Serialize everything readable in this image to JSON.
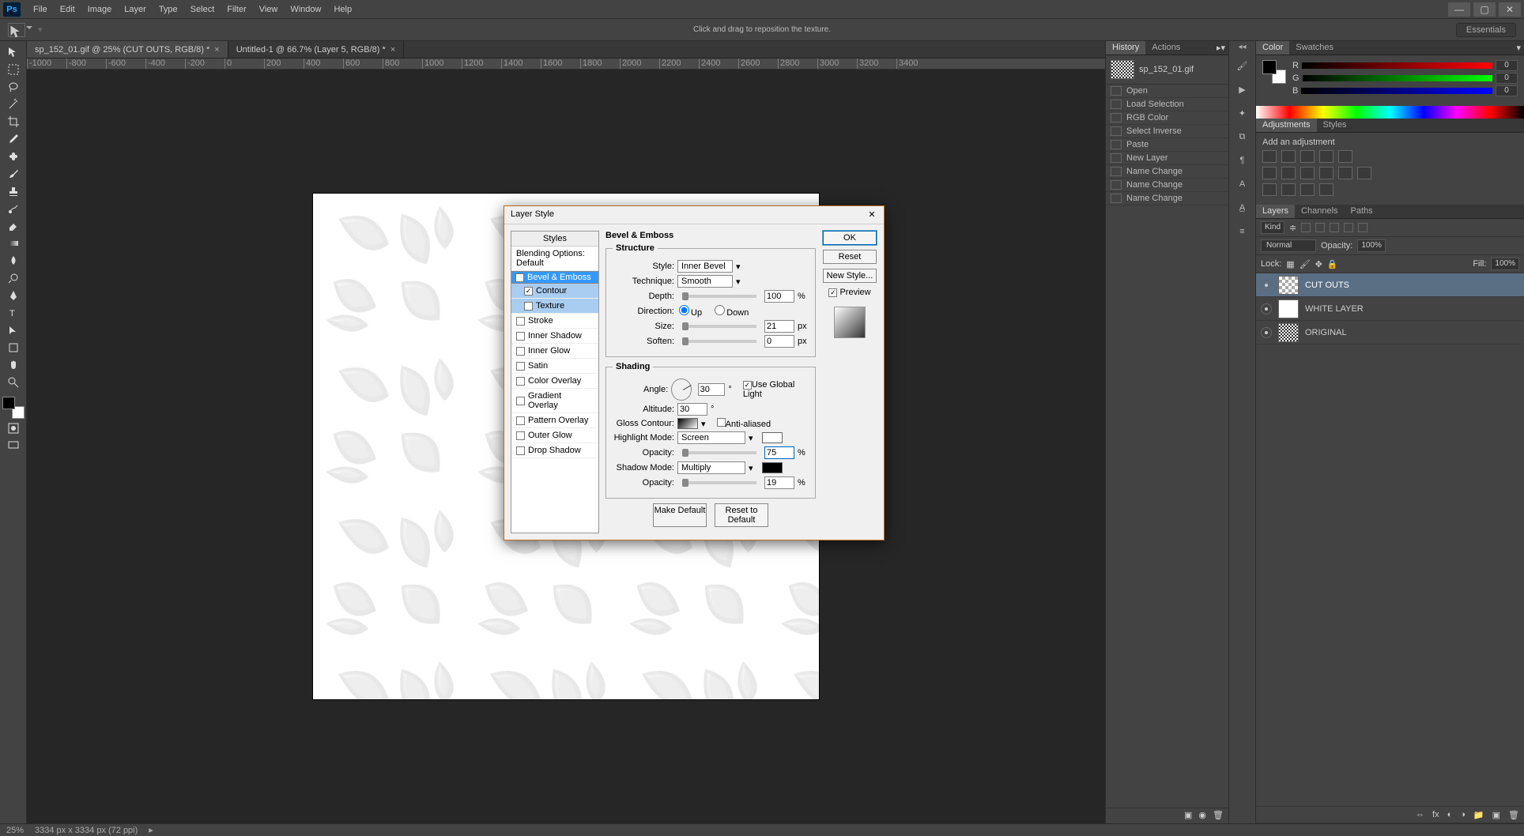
{
  "menu": {
    "items": [
      "File",
      "Edit",
      "Image",
      "Layer",
      "Type",
      "Select",
      "Filter",
      "View",
      "Window",
      "Help"
    ]
  },
  "optionsbar": {
    "hint": "Click and drag to reposition the texture.",
    "workspace": "Essentials"
  },
  "doctabs": [
    {
      "label": "sp_152_01.gif @ 25% (CUT OUTS, RGB/8) *",
      "active": true
    },
    {
      "label": "Untitled-1 @ 66.7% (Layer 5, RGB/8) *",
      "active": false
    }
  ],
  "ruler": [
    "-1000",
    "-800",
    "-600",
    "-400",
    "-200",
    "0",
    "200",
    "400",
    "600",
    "800",
    "1000",
    "1200",
    "1400",
    "1600",
    "1800",
    "2000",
    "2200",
    "2400",
    "2600",
    "2800",
    "3000",
    "3200",
    "3400"
  ],
  "status": {
    "zoom": "25%",
    "docinfo": "3334 px x 3334 px (72 ppi)"
  },
  "history": {
    "tabs": [
      "History",
      "Actions"
    ],
    "snapshot": "sp_152_01.gif",
    "items": [
      "Open",
      "Load Selection",
      "RGB Color",
      "Select Inverse",
      "Paste",
      "New Layer",
      "Name Change",
      "Name Change",
      "Name Change"
    ]
  },
  "color": {
    "tabs": [
      "Color",
      "Swatches"
    ],
    "r": "0",
    "g": "0",
    "b": "0"
  },
  "adjustments": {
    "tabs": [
      "Adjustments",
      "Styles"
    ],
    "hint": "Add an adjustment"
  },
  "layers": {
    "tabs": [
      "Layers",
      "Channels",
      "Paths"
    ],
    "kind": "Kind",
    "blend": "Normal",
    "opacity_label": "Opacity:",
    "opacity": "100%",
    "lock_label": "Lock:",
    "fill_label": "Fill:",
    "fill": "100%",
    "items": [
      {
        "name": "CUT OUTS",
        "selected": true,
        "thumb": "checker"
      },
      {
        "name": "WHITE LAYER",
        "selected": false,
        "thumb": "white"
      },
      {
        "name": "ORIGINAL",
        "selected": false,
        "thumb": "pattern"
      }
    ]
  },
  "dialog": {
    "title": "Layer Style",
    "styles_header": "Styles",
    "style_items": [
      {
        "label": "Blending Options: Default",
        "checked": false,
        "sel": false
      },
      {
        "label": "Bevel & Emboss",
        "checked": true,
        "sel": true
      },
      {
        "label": "Contour",
        "checked": true,
        "sub": true,
        "subsel": true
      },
      {
        "label": "Texture",
        "checked": false,
        "sub": true,
        "subsel": true
      },
      {
        "label": "Stroke",
        "checked": false
      },
      {
        "label": "Inner Shadow",
        "checked": false
      },
      {
        "label": "Inner Glow",
        "checked": false
      },
      {
        "label": "Satin",
        "checked": false
      },
      {
        "label": "Color Overlay",
        "checked": false
      },
      {
        "label": "Gradient Overlay",
        "checked": false
      },
      {
        "label": "Pattern Overlay",
        "checked": false
      },
      {
        "label": "Outer Glow",
        "checked": false
      },
      {
        "label": "Drop Shadow",
        "checked": false
      }
    ],
    "section": "Bevel & Emboss",
    "structure_legend": "Structure",
    "shading_legend": "Shading",
    "labels": {
      "style": "Style:",
      "technique": "Technique:",
      "depth": "Depth:",
      "direction": "Direction:",
      "up": "Up",
      "down": "Down",
      "size": "Size:",
      "soften": "Soften:",
      "angle": "Angle:",
      "use_global": "Use Global Light",
      "altitude": "Altitude:",
      "gloss": "Gloss Contour:",
      "antialias": "Anti-aliased",
      "highlight": "Highlight Mode:",
      "opacity": "Opacity:",
      "shadow": "Shadow Mode:"
    },
    "values": {
      "style": "Inner Bevel",
      "technique": "Smooth",
      "depth": "100",
      "size": "21",
      "soften": "0",
      "angle": "30",
      "altitude": "30",
      "highlight": "Screen",
      "opacity_h": "75",
      "shadow": "Multiply",
      "opacity_s": "19",
      "pct": "%",
      "px": "px",
      "deg": "°"
    },
    "buttons": {
      "ok": "OK",
      "reset": "Reset",
      "newstyle": "New Style...",
      "preview": "Preview",
      "make_default": "Make Default",
      "reset_default": "Reset to Default"
    }
  }
}
